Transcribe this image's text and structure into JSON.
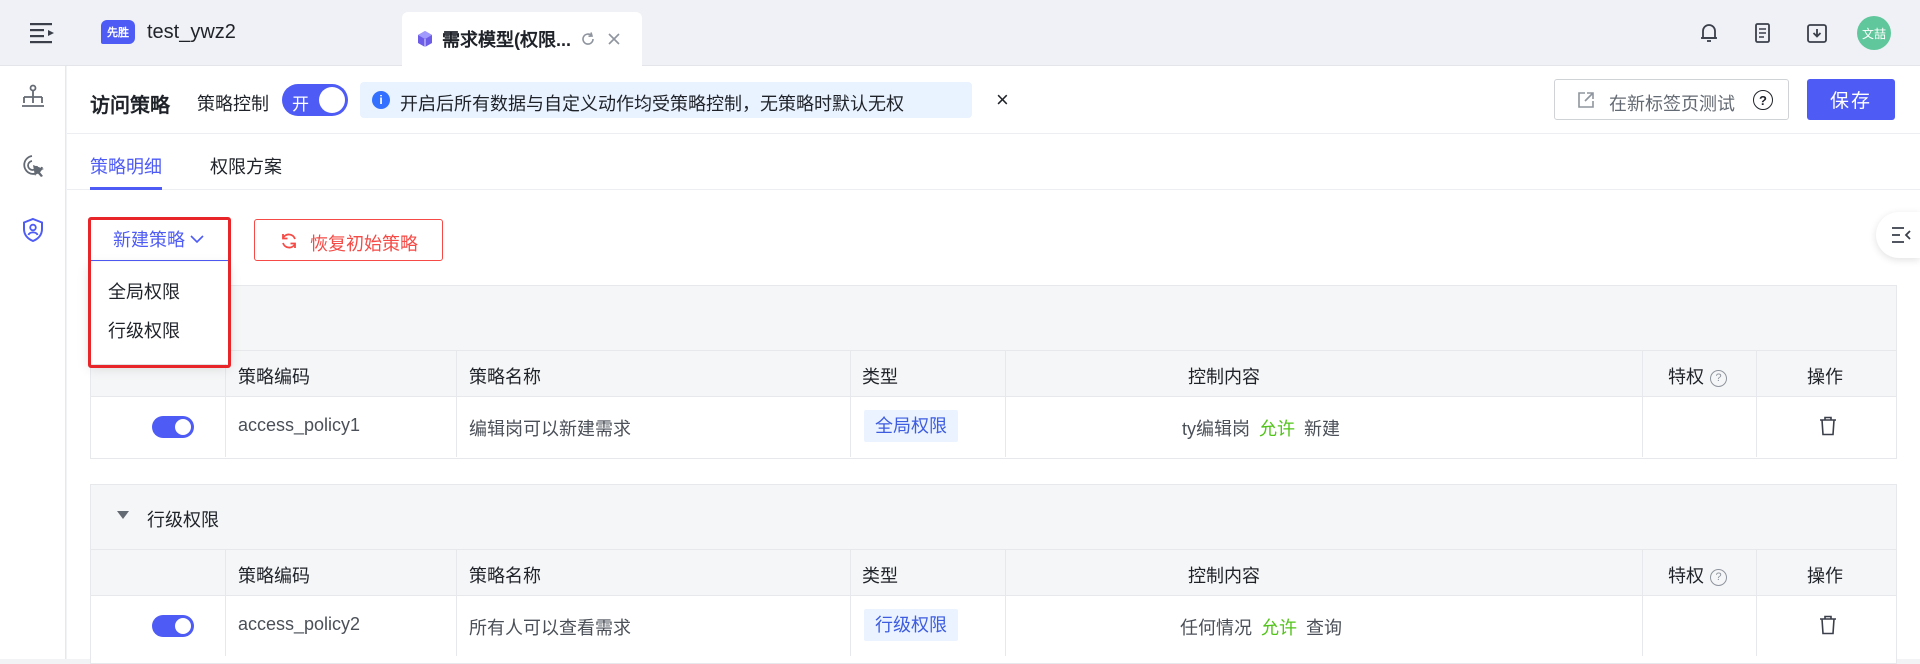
{
  "app": {
    "logo_text": "先胜",
    "name": "test_ywz2",
    "avatar_text": "文喆"
  },
  "tab": {
    "label": "需求模型(权限..."
  },
  "header": {
    "title": "访问策略",
    "control_label": "策略控制",
    "toggle_text": "开",
    "toggle_on": true,
    "info_text": "开启后所有数据与自定义动作均受策略控制，无策略时默认无权",
    "test_button": "在新标签页测试",
    "save_button": "保存"
  },
  "sub_tabs": [
    {
      "label": "策略明细",
      "active": true
    },
    {
      "label": "权限方案",
      "active": false
    }
  ],
  "toolbar": {
    "new_policy": "新建策略",
    "restore": "恢复初始策略"
  },
  "dropdown": {
    "items": [
      "全局权限",
      "行级权限"
    ]
  },
  "columns": [
    "策略编码",
    "策略名称",
    "类型",
    "控制内容",
    "特权",
    "操作"
  ],
  "groups": [
    {
      "title": "",
      "rows": [
        {
          "enabled": true,
          "code": "access_policy1",
          "name": "编辑岗可以新建需求",
          "type": "全局权限",
          "control": {
            "subject": "ty编辑岗",
            "effect": "允许",
            "action": "新建"
          }
        }
      ]
    },
    {
      "title": "行级权限",
      "rows": [
        {
          "enabled": true,
          "code": "access_policy2",
          "name": "所有人可以查看需求",
          "type": "行级权限",
          "control": {
            "subject": "任何情况",
            "effect": "允许",
            "action": "查询"
          }
        }
      ]
    }
  ],
  "colors": {
    "accent": "#4e5bf5",
    "danger": "#f54a45",
    "allow": "#52c41a",
    "info_bg": "#e9f2ff"
  }
}
